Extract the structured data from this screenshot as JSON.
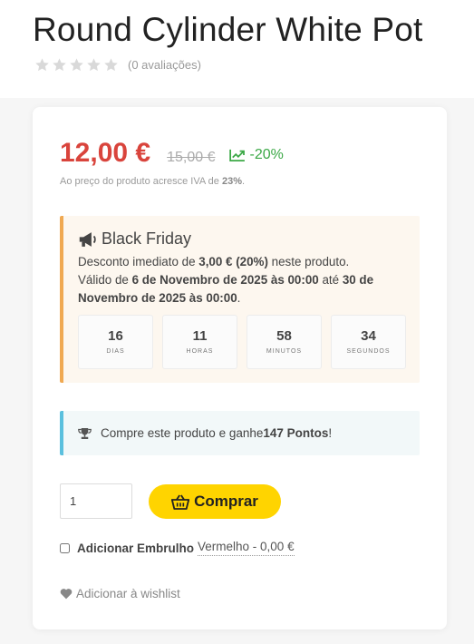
{
  "product": {
    "title": "Round Cylinder White Pot",
    "rating_count_text": "(0 avaliações)",
    "price_current": "12,00 €",
    "price_old": "15,00 €",
    "discount_percent": "-20%",
    "tax_note_prefix": "Ao preço do produto acresce IVA de ",
    "tax_rate": "23%",
    "tax_note_suffix": "."
  },
  "black_friday": {
    "title": "Black Friday",
    "line1_prefix": "Desconto imediato de ",
    "line1_amount": "3,00 € (20%)",
    "line1_suffix": " neste produto.",
    "line2_prefix": "Válido de ",
    "start_date": "6 de Novembro de 2025 às 00:00",
    "line2_middle": " até ",
    "end_date": "30 de Novembro de 2025 às 00:00",
    "line2_suffix": ".",
    "countdown": [
      {
        "value": "16",
        "label": "DIAS"
      },
      {
        "value": "11",
        "label": "HORAS"
      },
      {
        "value": "58",
        "label": "MINUTOS"
      },
      {
        "value": "34",
        "label": "SEGUNDOS"
      }
    ]
  },
  "points": {
    "prefix": "Compre este produto e ganhe ",
    "amount": "147 Pontos",
    "suffix": "!"
  },
  "purchase": {
    "quantity": "1",
    "buy_label": "Comprar"
  },
  "gift": {
    "label": "Adicionar Embrulho",
    "option": "Vermelho - 0,00 €"
  },
  "wishlist_label": "Adicionar à wishlist",
  "colors": {
    "price": "#d9443c",
    "discount": "#3aa845",
    "buy_button": "#ffd400",
    "black_friday_accent": "#f0a952",
    "points_accent": "#5bc0de",
    "star_empty": "#d9d9d9"
  },
  "icons": {
    "rating": "star-icon",
    "discount": "trend-up-icon",
    "black_friday": "megaphone-icon",
    "points": "trophy-icon",
    "buy": "basket-icon",
    "wishlist": "heart-icon"
  }
}
